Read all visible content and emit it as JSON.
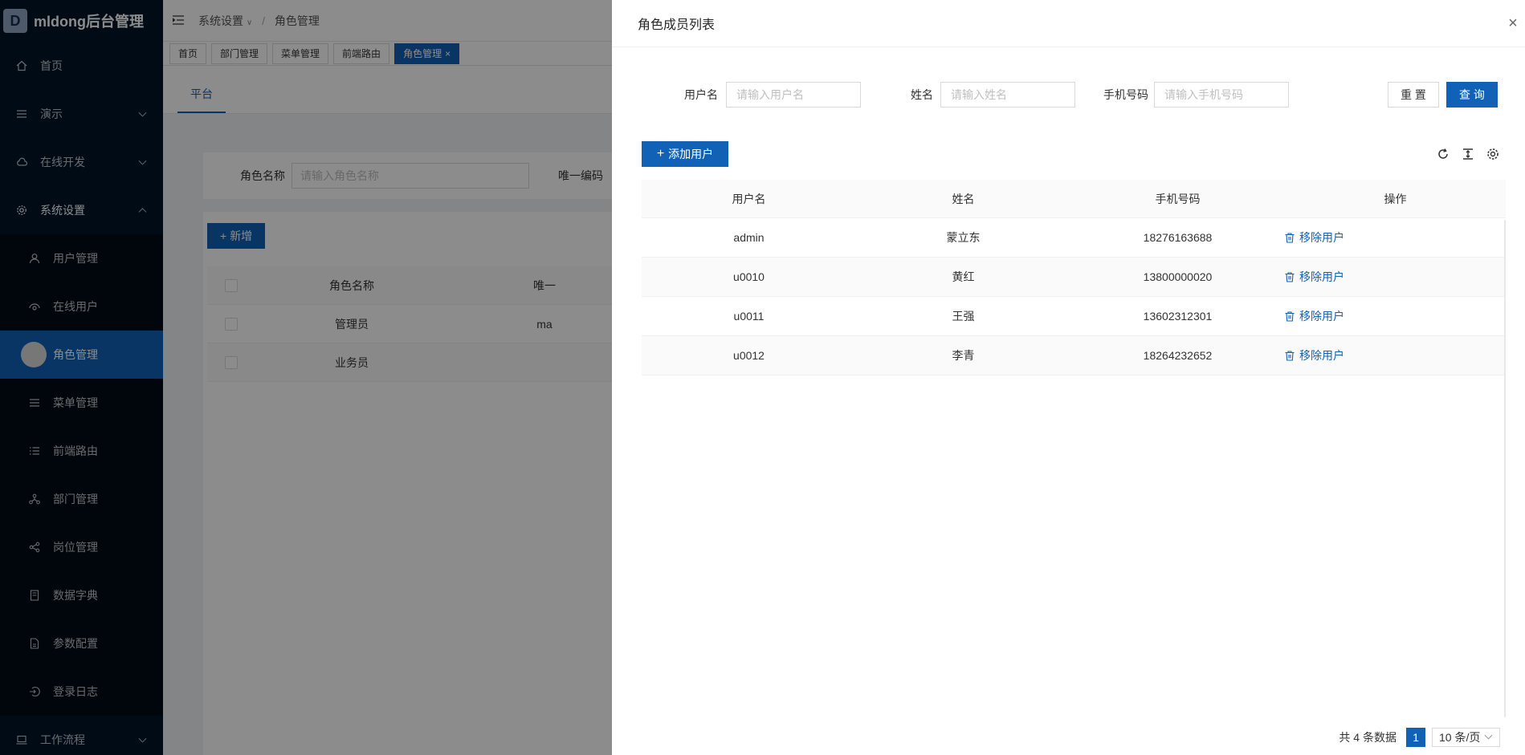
{
  "app": {
    "title": "mldong后台管理",
    "logo_letter": "D"
  },
  "sidebar": {
    "items": [
      {
        "label": "首页",
        "icon": "home-icon"
      },
      {
        "label": "演示",
        "icon": "list-icon",
        "expandable": true
      },
      {
        "label": "在线开发",
        "icon": "cloud-icon",
        "expandable": true
      },
      {
        "label": "系统设置",
        "icon": "gear-icon",
        "expandable": true,
        "expanded": true
      }
    ],
    "subitems": [
      {
        "label": "用户管理",
        "icon": "user-icon"
      },
      {
        "label": "在线用户",
        "icon": "online-user-icon"
      },
      {
        "label": "角色管理",
        "icon": "role-icon",
        "active": true
      },
      {
        "label": "菜单管理",
        "icon": "menu-icon"
      },
      {
        "label": "前端路由",
        "icon": "route-icon"
      },
      {
        "label": "部门管理",
        "icon": "dept-icon"
      },
      {
        "label": "岗位管理",
        "icon": "share-icon"
      },
      {
        "label": "数据字典",
        "icon": "book-icon"
      },
      {
        "label": "参数配置",
        "icon": "file-icon"
      },
      {
        "label": "登录日志",
        "icon": "login-icon"
      }
    ],
    "bottom_item": {
      "label": "工作流程",
      "icon": "laptop-icon",
      "expandable": true
    }
  },
  "breadcrumb": {
    "level1": "系统设置",
    "level2": "角色管理"
  },
  "page_tabs": [
    "首页",
    "部门管理",
    "菜单管理",
    "前端路由",
    "角色管理"
  ],
  "active_page_tab_close": "×",
  "sub_tab": "平台",
  "bg_search": {
    "label": "角色名称",
    "placeholder": "请输入角色名称",
    "label2": "唯一编码"
  },
  "bg_table": {
    "add_label": "新增",
    "headers": [
      "角色名称",
      "唯一"
    ],
    "rows": [
      [
        "管理员",
        "ma"
      ],
      [
        "业务员",
        ""
      ]
    ]
  },
  "drawer": {
    "title": "角色成员列表",
    "close_glyph": "×",
    "filters": [
      {
        "label": "用户名",
        "placeholder": "请输入用户名"
      },
      {
        "label": "姓名",
        "placeholder": "请输入姓名"
      },
      {
        "label": "手机号码",
        "placeholder": "请输入手机号码"
      }
    ],
    "reset_label": "重 置",
    "query_label": "查 询",
    "add_user_label": "添加用户",
    "columns": [
      "用户名",
      "姓名",
      "手机号码",
      "操作"
    ],
    "rows": [
      {
        "username": "admin",
        "name": "蒙立东",
        "phone": "18276163688",
        "action": "移除用户"
      },
      {
        "username": "u0010",
        "name": "黄红",
        "phone": "13800000020",
        "action": "移除用户"
      },
      {
        "username": "u0011",
        "name": "王强",
        "phone": "13602312301",
        "action": "移除用户"
      },
      {
        "username": "u0012",
        "name": "李青",
        "phone": "18264232652",
        "action": "移除用户"
      }
    ],
    "pagination": {
      "total_text": "共 4 条数据",
      "current_page": "1",
      "page_size": "10 条/页"
    }
  },
  "colors": {
    "primary": "#1162b6",
    "sidebar_bg": "#001529"
  }
}
